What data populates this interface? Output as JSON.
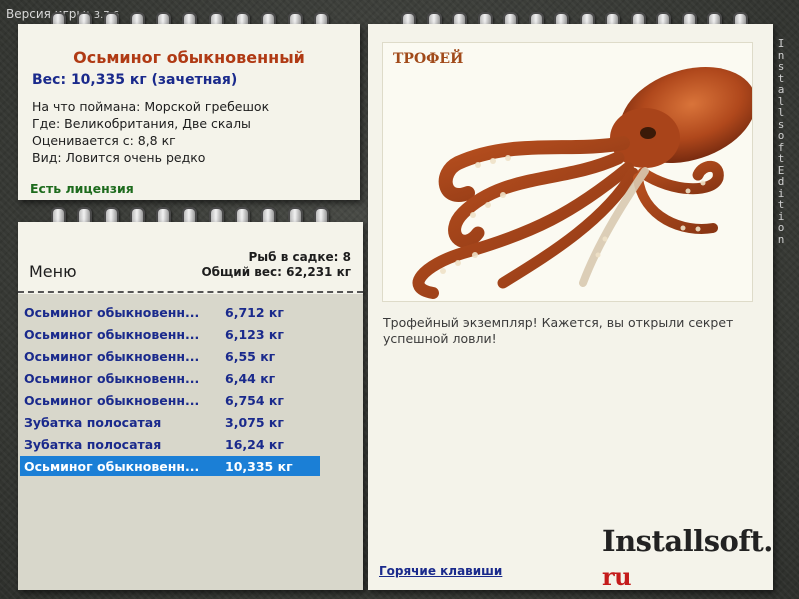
{
  "header": {
    "version_label": "Версия игры:",
    "version_number": "3.7.6"
  },
  "fish_info": {
    "name": "Осьминог обыкновенный",
    "weight": "Вес: 10,335 кг (зачетная)",
    "caught_on": "На что поймана: Морской гребешок",
    "location": "Где: Великобритания, Две скалы",
    "valued_from": "Оценивается с: 8,8 кг",
    "kind": "Вид: Ловится очень редко",
    "license": "Есть лицензия"
  },
  "catch_list": {
    "menu_label": "Меню",
    "fish_count": "Рыб в садке: 8",
    "total_weight": "Общий вес: 62,231 кг",
    "rows": [
      {
        "name": "Осьминог обыкновенный",
        "weight": "6,712 кг",
        "selected": false
      },
      {
        "name": "Осьминог обыкновенный",
        "weight": "6,123 кг",
        "selected": false
      },
      {
        "name": "Осьминог обыкновенный",
        "weight": "6,55 кг",
        "selected": false
      },
      {
        "name": "Осьминог обыкновенный",
        "weight": "6,44 кг",
        "selected": false
      },
      {
        "name": "Осьминог обыкновенный",
        "weight": "6,754 кг",
        "selected": false
      },
      {
        "name": "Зубатка полосатая",
        "weight": "3,075 кг",
        "selected": false
      },
      {
        "name": "Зубатка полосатая",
        "weight": "16,24 кг",
        "selected": false
      },
      {
        "name": "Осьминог обыкновенный",
        "weight": "10,335 кг",
        "selected": true
      }
    ]
  },
  "trophy": {
    "badge": "ТРОФЕЙ",
    "caption": "Трофейный экземпляр! Кажется, вы открыли секрет успешной ловли!"
  },
  "footer": {
    "hotkeys_link": "Горячие клавиши",
    "logo_main": "Installsoft.",
    "logo_tld": "ru",
    "edition_text": "Installsoft Edition"
  },
  "colors": {
    "selection": "#1b7fd6",
    "title": "#b03a14",
    "link": "#1a2a8c",
    "license": "#1d6b1d"
  },
  "icons": [
    "spiral-ring-icon",
    "octopus-image"
  ]
}
